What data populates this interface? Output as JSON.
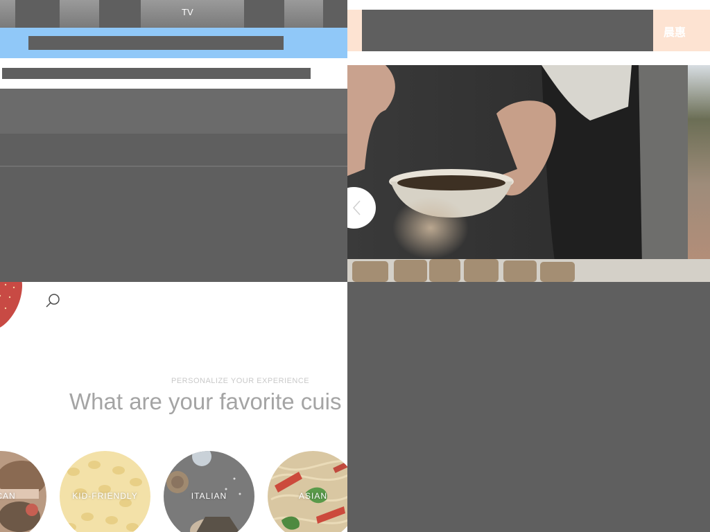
{
  "top_strip": {
    "tv_label": "TV"
  },
  "right_header": {
    "peach_button_text": "晨惠"
  },
  "search": {
    "icon": "search-icon"
  },
  "personalize": {
    "eyebrow": "PERSONALIZE YOUR EXPERIENCE",
    "headline": "What are your favorite cuis"
  },
  "cuisines": [
    {
      "label": "RICAN"
    },
    {
      "label": "KID-FRIENDLY"
    },
    {
      "label": "ITALIAN"
    },
    {
      "label": "ASIAN"
    }
  ],
  "hero": {
    "prev_icon": "chevron-left-icon"
  },
  "colors": {
    "blue_bar": "#90c8f8",
    "peach": "#fde3d2",
    "placeholder_grey": "#5f5f5f",
    "headline_grey": "#a4a4a4"
  }
}
